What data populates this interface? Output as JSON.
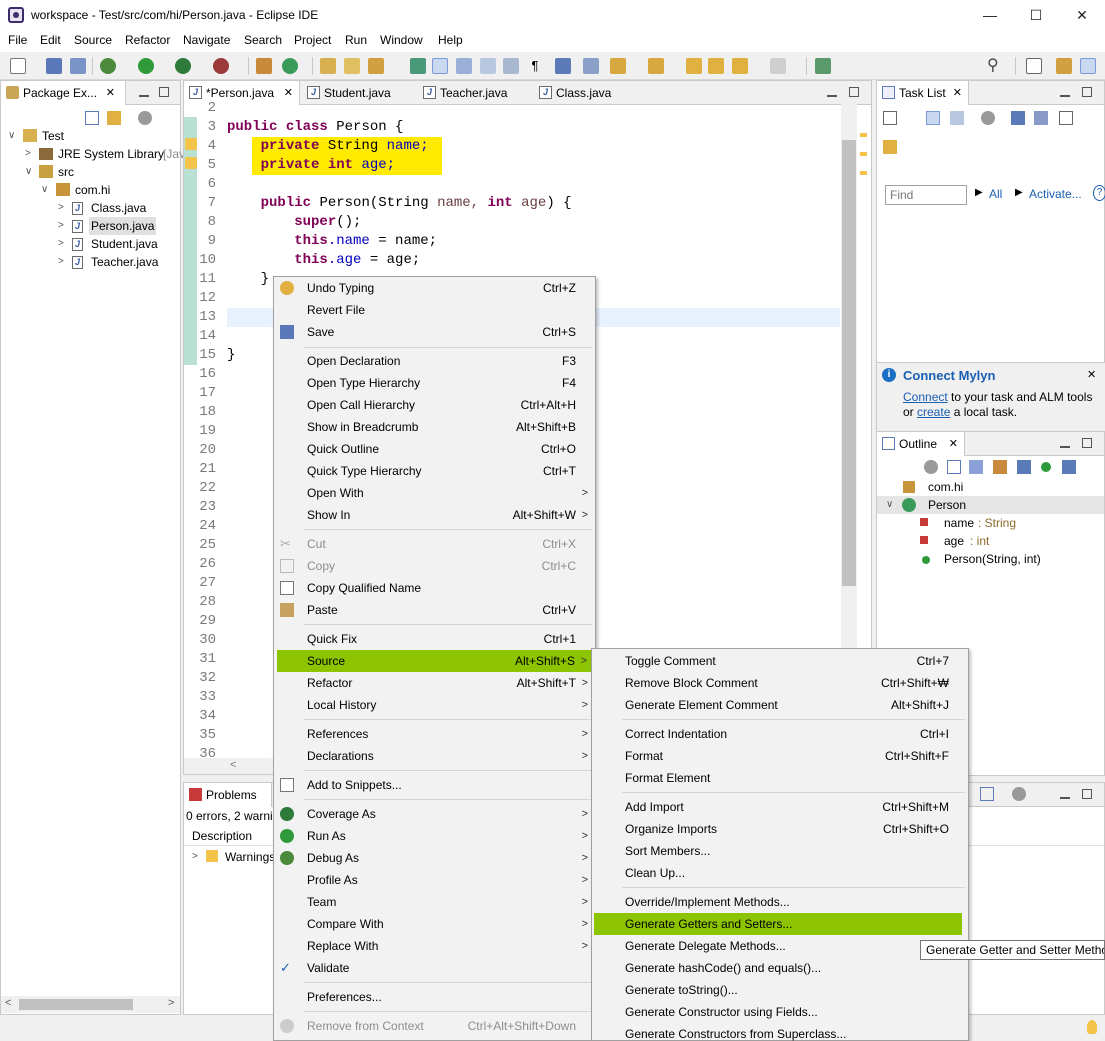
{
  "window": {
    "title": "workspace - Test/src/com/hi/Person.java - Eclipse IDE"
  },
  "menubar": [
    "File",
    "Edit",
    "Source",
    "Refactor",
    "Navigate",
    "Search",
    "Project",
    "Run",
    "Window",
    "Help"
  ],
  "package_explorer": {
    "tab": "Package Ex...",
    "items": [
      "Test",
      "JRE System Library",
      "[Jav",
      "src",
      "com.hi",
      "Class.java",
      "Person.java",
      "Student.java",
      "Teacher.java"
    ]
  },
  "editor": {
    "tabs": [
      "*Person.java",
      "Student.java",
      "Teacher.java",
      "Class.java"
    ],
    "line_numbers": [
      "2",
      "3",
      "4",
      "5",
      "6",
      "7",
      "8",
      "9",
      "10",
      "11",
      "12",
      "13",
      "14",
      "15",
      "16",
      "17",
      "18",
      "19",
      "20",
      "21",
      "22",
      "23",
      "24",
      "25",
      "26",
      "27",
      "28",
      "29",
      "30",
      "31",
      "32",
      "33",
      "34",
      "35",
      "36"
    ],
    "code": {
      "kw_public": "public",
      "kw_class": "class",
      "class_name": "Person {",
      "kw_private": "private",
      "type_string": "String",
      "field_name": "name;",
      "kw_int": "int",
      "field_age": "age;",
      "ctor_sig": "Person(String",
      "param_name": "name,",
      "param_age": "age",
      "ctor_open": ") {",
      "kw_super": "super",
      "super_call": "();",
      "kw_this": "this",
      "dot_name": ".name",
      "assign_name": " = name;",
      "dot_age": ".age",
      "assign_age": " = age;",
      "close_brace": "}"
    }
  },
  "context_menu": [
    {
      "label": "Undo Typing",
      "shortcut": "Ctrl+Z"
    },
    {
      "label": "Revert File",
      "shortcut": ""
    },
    {
      "label": "Save",
      "shortcut": "Ctrl+S"
    },
    {
      "label": "Open Declaration",
      "shortcut": "F3"
    },
    {
      "label": "Open Type Hierarchy",
      "shortcut": "F4"
    },
    {
      "label": "Open Call Hierarchy",
      "shortcut": "Ctrl+Alt+H"
    },
    {
      "label": "Show in Breadcrumb",
      "shortcut": "Alt+Shift+B"
    },
    {
      "label": "Quick Outline",
      "shortcut": "Ctrl+O"
    },
    {
      "label": "Quick Type Hierarchy",
      "shortcut": "Ctrl+T"
    },
    {
      "label": "Open With",
      "shortcut": ""
    },
    {
      "label": "Show In",
      "shortcut": "Alt+Shift+W"
    },
    {
      "label": "Cut",
      "shortcut": "Ctrl+X"
    },
    {
      "label": "Copy",
      "shortcut": "Ctrl+C"
    },
    {
      "label": "Copy Qualified Name",
      "shortcut": ""
    },
    {
      "label": "Paste",
      "shortcut": "Ctrl+V"
    },
    {
      "label": "Quick Fix",
      "shortcut": "Ctrl+1"
    },
    {
      "label": "Source",
      "shortcut": "Alt+Shift+S"
    },
    {
      "label": "Refactor",
      "shortcut": "Alt+Shift+T"
    },
    {
      "label": "Local History",
      "shortcut": ""
    },
    {
      "label": "References",
      "shortcut": ""
    },
    {
      "label": "Declarations",
      "shortcut": ""
    },
    {
      "label": "Add to Snippets...",
      "shortcut": ""
    },
    {
      "label": "Coverage As",
      "shortcut": ""
    },
    {
      "label": "Run As",
      "shortcut": ""
    },
    {
      "label": "Debug As",
      "shortcut": ""
    },
    {
      "label": "Profile As",
      "shortcut": ""
    },
    {
      "label": "Team",
      "shortcut": ""
    },
    {
      "label": "Compare With",
      "shortcut": ""
    },
    {
      "label": "Replace With",
      "shortcut": ""
    },
    {
      "label": "Validate",
      "shortcut": ""
    },
    {
      "label": "Preferences...",
      "shortcut": ""
    },
    {
      "label": "Remove from Context",
      "shortcut": "Ctrl+Alt+Shift+Down"
    }
  ],
  "source_submenu": [
    {
      "label": "Toggle Comment",
      "shortcut": "Ctrl+7"
    },
    {
      "label": "Remove Block Comment",
      "shortcut": "Ctrl+Shift+₩"
    },
    {
      "label": "Generate Element Comment",
      "shortcut": "Alt+Shift+J"
    },
    {
      "label": "Correct Indentation",
      "shortcut": "Ctrl+I"
    },
    {
      "label": "Format",
      "shortcut": "Ctrl+Shift+F"
    },
    {
      "label": "Format Element",
      "shortcut": ""
    },
    {
      "label": "Add Import",
      "shortcut": "Ctrl+Shift+M"
    },
    {
      "label": "Organize Imports",
      "shortcut": "Ctrl+Shift+O"
    },
    {
      "label": "Sort Members...",
      "shortcut": ""
    },
    {
      "label": "Clean Up...",
      "shortcut": ""
    },
    {
      "label": "Override/Implement Methods...",
      "shortcut": ""
    },
    {
      "label": "Generate Getters and Setters...",
      "shortcut": ""
    },
    {
      "label": "Generate Delegate Methods...",
      "shortcut": ""
    },
    {
      "label": "Generate hashCode() and equals()...",
      "shortcut": ""
    },
    {
      "label": "Generate toString()...",
      "shortcut": ""
    },
    {
      "label": "Generate Constructor using Fields...",
      "shortcut": ""
    },
    {
      "label": "Generate Constructors from Superclass...",
      "shortcut": ""
    }
  ],
  "tooltip": "Generate Getter and Setter Metho",
  "task_list": {
    "tab": "Task List",
    "find_placeholder": "Find",
    "all": "All",
    "activate": "Activate..."
  },
  "mylyn": {
    "title": "Connect Mylyn",
    "connect": "Connect",
    "text1": " to your task and ALM tools",
    "or": "or ",
    "create": "create",
    "text2": " a local task."
  },
  "outline": {
    "tab": "Outline",
    "package": "com.hi",
    "class": "Person",
    "members": [
      {
        "name": "name",
        "type": " : String"
      },
      {
        "name": "age",
        "type": " : int"
      },
      {
        "name": "Person(String, int)",
        "type": ""
      }
    ]
  },
  "problems": {
    "tab": "Problems",
    "summary": "0 errors, 2 warni",
    "column": "Description",
    "row": "Warnings"
  },
  "colors": {
    "accent_green": "#8dc400",
    "highlight_yellow": "#ffea00"
  }
}
